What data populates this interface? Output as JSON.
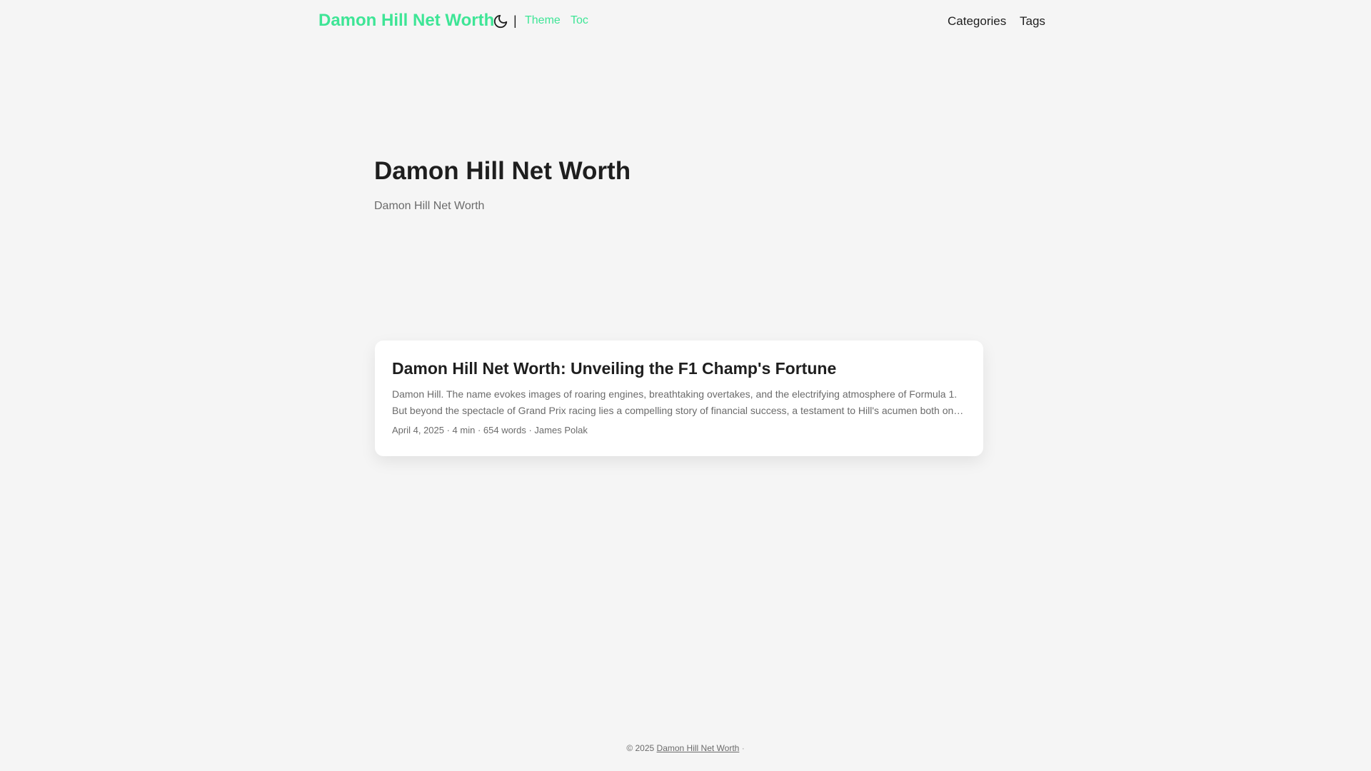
{
  "header": {
    "site_title": "Damon Hill Net Worth",
    "theme_icon": "moon-icon",
    "separator": "|",
    "links": {
      "theme": "Theme",
      "toc": "Toc"
    },
    "nav": {
      "categories": "Categories",
      "tags": "Tags"
    }
  },
  "main": {
    "title": "Damon Hill Net Worth",
    "subtitle": "Damon Hill Net Worth"
  },
  "post": {
    "title": "Damon Hill Net Worth: Unveiling the F1 Champ's Fortune",
    "excerpt": "Damon Hill. The name evokes images of roaring engines, breathtaking overtakes, and the electrifying atmosphere of Formula 1. But beyond the spectacle of Grand Prix racing lies a compelling story of financial success, a testament to Hill's acumen both on and off the track.",
    "meta": "April 4, 2025 · 4 min · 654 words · James Polak"
  },
  "footer": {
    "copyright": "© 2025",
    "site_link": "Damon Hill Net Worth",
    "dot": "·"
  },
  "colors": {
    "accent": "#3ee596",
    "background": "#f5f5f5",
    "card": "#ffffff",
    "text": "#1e1e1e",
    "muted": "#6b6b6b"
  }
}
